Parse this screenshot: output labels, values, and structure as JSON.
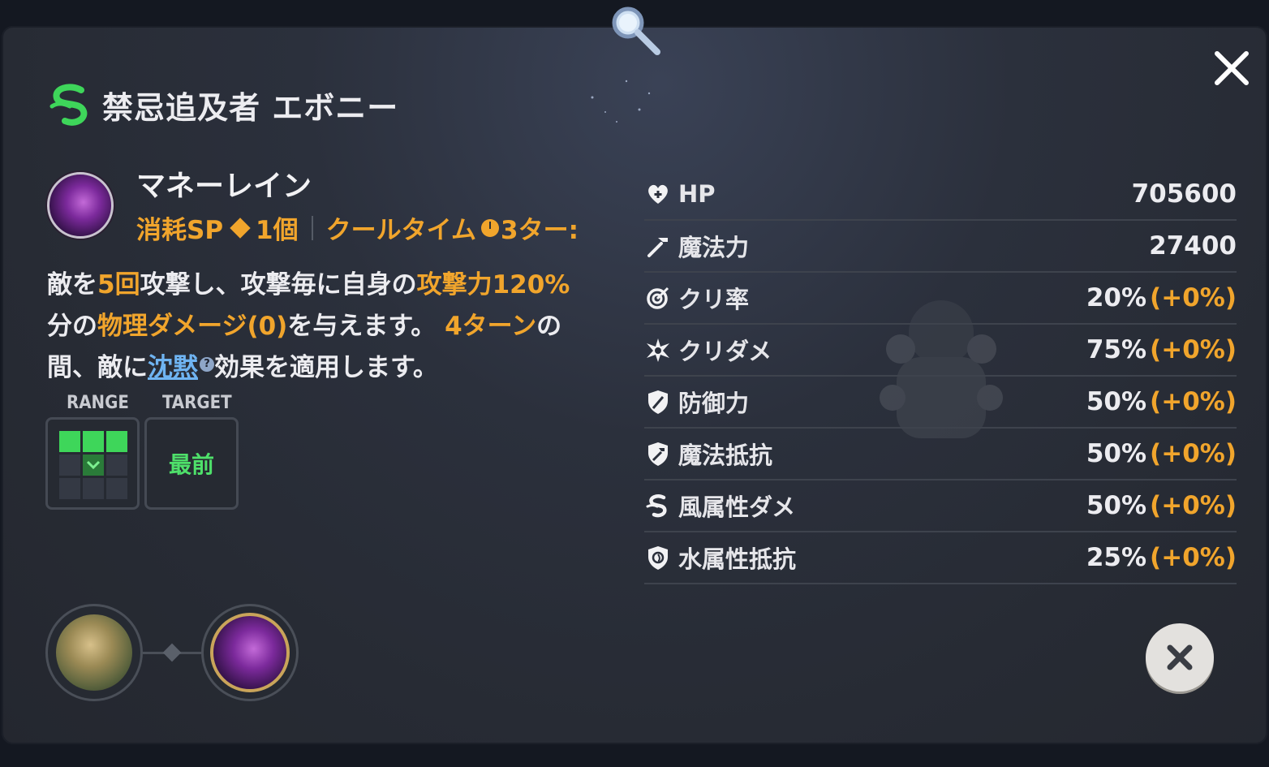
{
  "character": {
    "name": "禁忌追及者 エボニー"
  },
  "skill": {
    "name": "マネーレイン",
    "sp_label": "消耗SP",
    "sp_cost": "1個",
    "cooldown_label": "クールタイム",
    "cooldown_value": "3ター:",
    "description": {
      "p1": "敵を",
      "p2": "5回",
      "p3": "攻撃し、攻撃毎に自身の",
      "p4": "攻撃力120%",
      "p5": "分の",
      "p6": "物理ダメージ(0)",
      "p7": "を与えます。 ",
      "p8": "4ターン",
      "p9": "の間、敵に",
      "p10": "沈黙",
      "p11": "?",
      "p12": "効果を適用します。"
    },
    "range_label": "RANGE",
    "target_label": "TARGET",
    "target_value": "最前"
  },
  "stats": [
    {
      "icon": "heart-icon",
      "label": "HP",
      "value": "705600",
      "bonus": ""
    },
    {
      "icon": "magic-wand-icon",
      "label": "魔法力",
      "value": "27400",
      "bonus": ""
    },
    {
      "icon": "crit-rate-icon",
      "label": "クリ率",
      "value": "20%",
      "bonus": "(+0%)"
    },
    {
      "icon": "crit-damage-icon",
      "label": "クリダメ",
      "value": "75%",
      "bonus": "(+0%)"
    },
    {
      "icon": "shield-sword-icon",
      "label": "防御力",
      "value": "50%",
      "bonus": "(+0%)"
    },
    {
      "icon": "magic-shield-icon",
      "label": "魔法抵抗",
      "value": "50%",
      "bonus": "(+0%)"
    },
    {
      "icon": "wind-icon",
      "label": "風属性ダメ",
      "value": "50%",
      "bonus": "(+0%)"
    },
    {
      "icon": "water-shield-icon",
      "label": "水属性抵抗",
      "value": "25%",
      "bonus": "(+0%)"
    }
  ],
  "colors": {
    "accent": "#f1a52c",
    "wind": "#3ed65a",
    "link": "#6fb4f2"
  }
}
